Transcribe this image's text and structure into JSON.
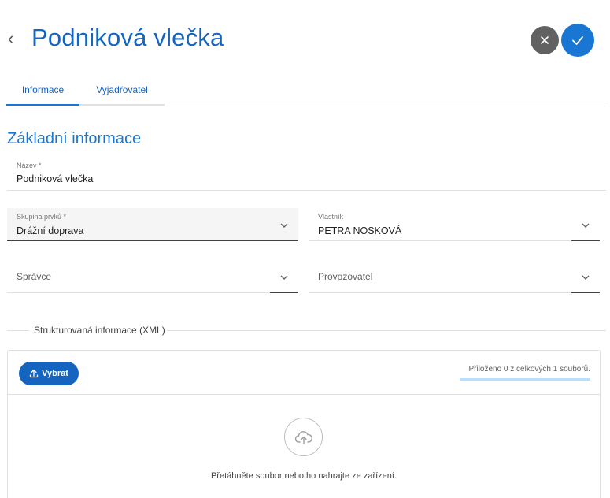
{
  "header": {
    "back_icon": "chevron-left-icon",
    "title": "Podniková vlečka",
    "cancel_icon": "close-icon",
    "confirm_icon": "check-icon",
    "colors": {
      "accent": "#1976d2",
      "cancel": "#616161"
    }
  },
  "tabs": [
    {
      "label": "Informace",
      "active": true
    },
    {
      "label": "Vyjadřovatel",
      "active": false
    }
  ],
  "section": {
    "title": "Základní informace"
  },
  "fields": {
    "name": {
      "label": "Název *",
      "value": "Podniková vlečka"
    },
    "group": {
      "label": "Skupina prvků *",
      "value": "Drážní doprava"
    },
    "owner": {
      "label": "Vlastník",
      "value": "PETRA NOSKOVÁ"
    },
    "admin": {
      "placeholder": "Správce"
    },
    "operator": {
      "placeholder": "Provozovatel"
    }
  },
  "attachments": {
    "legend": "Strukturovaná informace (XML)",
    "select_label": "Vybrat",
    "select_icon": "upload-icon",
    "status": "Přiloženo 0 z celkových 1 souborů.",
    "progress_fraction": 0,
    "drop_icon": "cloud-upload-icon",
    "drop_text": "Přetáhněte soubor nebo ho nahrajte ze zařízení."
  }
}
